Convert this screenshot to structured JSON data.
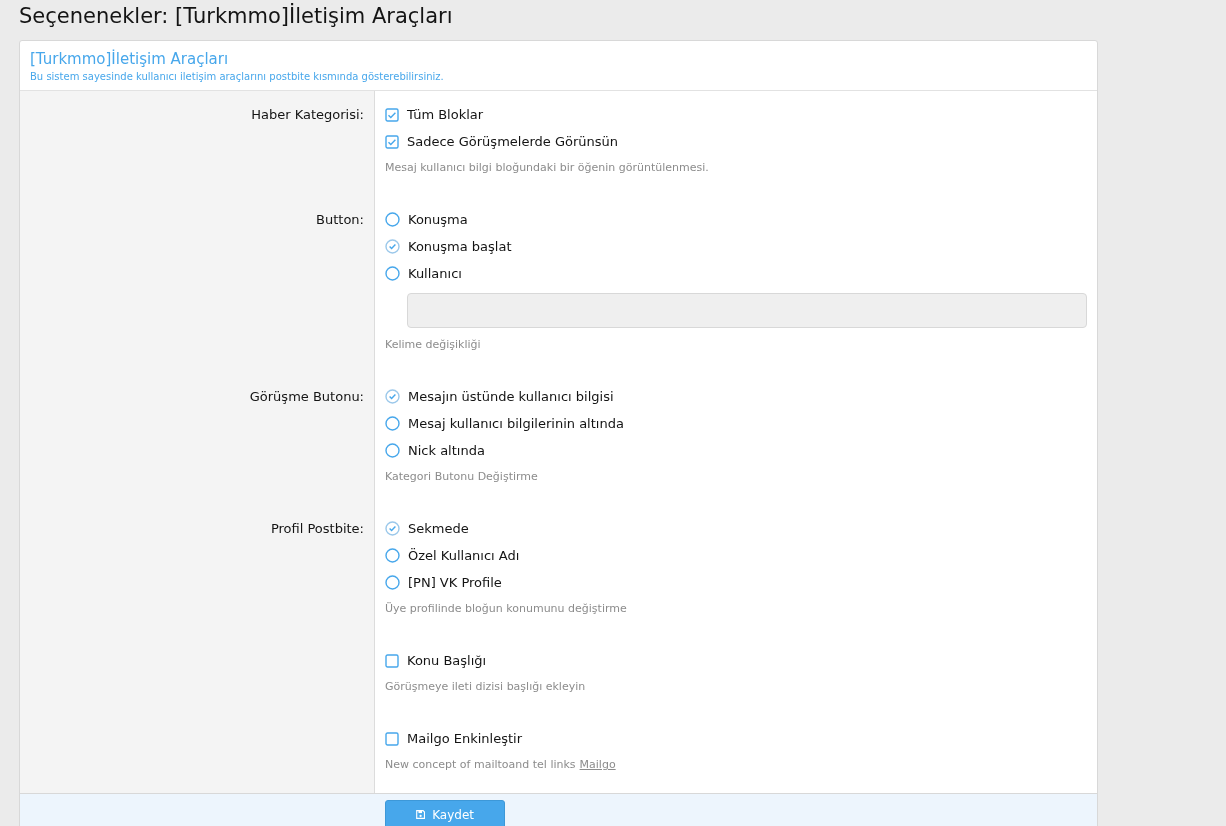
{
  "page_title": "Seçenenekler: [Turkmmo]İletişim Araçları",
  "panel": {
    "title": "[Turkmmo]İletişim Araçları",
    "description": "Bu sistem sayesinde kullanıcı iletişim araçlarını postbite kısmında gösterebilirsiniz."
  },
  "sections": [
    {
      "label": "Haber Kategorisi:",
      "options": [
        {
          "kind": "checkbox",
          "label": "Tüm Bloklar",
          "checked": true
        },
        {
          "kind": "checkbox",
          "label": "Sadece Görüşmelerde Görünsün",
          "checked": true
        }
      ],
      "hint": "Mesaj kullanıcı bilgi bloğundaki bir öğenin görüntülenmesi."
    },
    {
      "label": "Button:",
      "options": [
        {
          "kind": "radio",
          "label": "Konuşma",
          "selected": false
        },
        {
          "kind": "radio",
          "label": "Konuşma başlat",
          "selected": true
        },
        {
          "kind": "radio",
          "label": "Kullanıcı",
          "selected": false
        }
      ],
      "text_field": {
        "disabled": true
      },
      "hint": "Kelime değişikliği"
    },
    {
      "label": "Görüşme Butonu:",
      "options": [
        {
          "kind": "radio",
          "label": "Mesajın üstünde kullanıcı bilgisi",
          "selected": true
        },
        {
          "kind": "radio",
          "label": "Mesaj kullanıcı bilgilerinin altında",
          "selected": false
        },
        {
          "kind": "radio",
          "label": "Nick altında",
          "selected": false
        }
      ],
      "hint": "Kategori Butonu Değiştirme"
    },
    {
      "label": "Profil Postbite:",
      "options": [
        {
          "kind": "radio",
          "label": "Sekmede",
          "selected": true
        },
        {
          "kind": "radio",
          "label": "Özel Kullanıcı Adı",
          "selected": false
        },
        {
          "kind": "radio",
          "label": "[PN] VK Profile",
          "selected": false
        }
      ],
      "hint": "Üye profilinde bloğun konumunu değiştirme"
    },
    {
      "options": [
        {
          "kind": "checkbox",
          "label": "Konu Başlığı",
          "checked": false
        }
      ],
      "hint": "Görüşmeye ileti dizisi başlığı ekleyin"
    },
    {
      "options": [
        {
          "kind": "checkbox",
          "label": "Mailgo Enkinleştir",
          "checked": false
        }
      ],
      "hint": "New concept of mailtoand tel links",
      "hint_link": "Mailgo"
    }
  ],
  "save_button": "Kaydet"
}
